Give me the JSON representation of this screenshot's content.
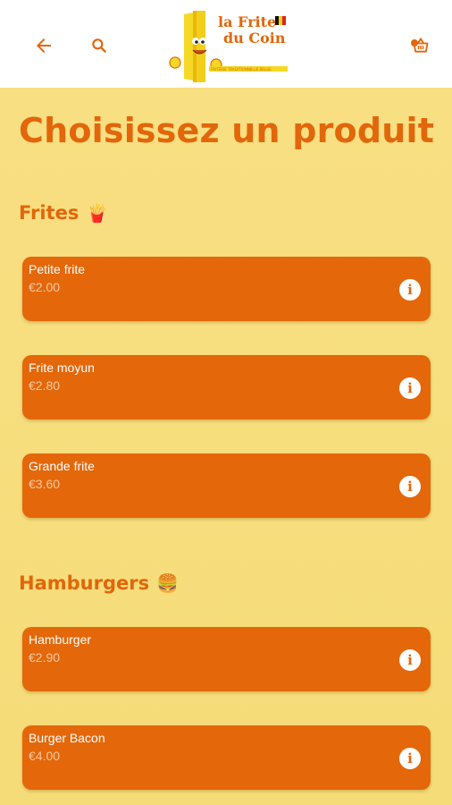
{
  "header": {
    "logo_text_line1": "la Frite",
    "logo_text_line2": "du Coin",
    "logo_tagline": "FRITERIE TRADITIONNELLE BELGE",
    "icons": [
      "back-arrow-icon",
      "search-icon",
      "cart-icon"
    ]
  },
  "page": {
    "title": "Choisissez un produit"
  },
  "sections": [
    {
      "title": "Frites",
      "emoji": "🍟",
      "products": [
        {
          "name": "Petite frite",
          "price": "€2.00"
        },
        {
          "name": "Frite moyun",
          "price": "€2.80"
        },
        {
          "name": "Grande frite",
          "price": "€3.60"
        }
      ]
    },
    {
      "title": "Hamburgers",
      "emoji": "🍔",
      "products": [
        {
          "name": "Hamburger",
          "price": "€2.90"
        },
        {
          "name": "Burger Bacon",
          "price": "€4.00"
        }
      ]
    }
  ],
  "colors": {
    "accent": "#e2660a",
    "card": "#e4670a",
    "background": "#f7dd7a",
    "price": "#f5c9a2"
  }
}
